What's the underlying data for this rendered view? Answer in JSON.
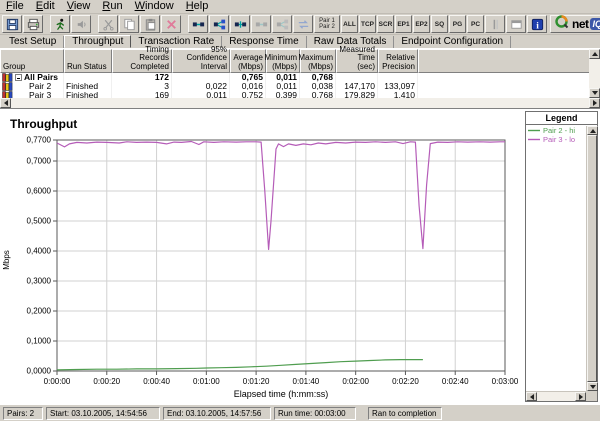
{
  "menu": {
    "items": [
      {
        "label": "File"
      },
      {
        "label": "Edit"
      },
      {
        "label": "View"
      },
      {
        "label": "Run"
      },
      {
        "label": "Window"
      },
      {
        "label": "Help"
      }
    ]
  },
  "toolbar": {
    "items": [
      {
        "type": "button",
        "name": "save-button",
        "icon": "floppy-icon",
        "enabled": true
      },
      {
        "type": "button",
        "name": "print-button",
        "icon": "printer-icon",
        "enabled": true
      },
      {
        "type": "separator"
      },
      {
        "type": "button",
        "name": "run-test-button",
        "icon": "runner-icon",
        "enabled": true
      },
      {
        "type": "button",
        "name": "stop-run-button",
        "icon": "speaker-icon",
        "enabled": false
      },
      {
        "type": "separator"
      },
      {
        "type": "button",
        "name": "cut-button",
        "icon": "scissors-icon",
        "enabled": false
      },
      {
        "type": "button",
        "name": "copy-button",
        "icon": "copy-icon",
        "enabled": false
      },
      {
        "type": "button",
        "name": "paste-button",
        "icon": "paste-icon",
        "enabled": false
      },
      {
        "type": "button",
        "name": "delete-button",
        "icon": "delete-x-icon",
        "enabled": true
      },
      {
        "type": "separator"
      },
      {
        "type": "button",
        "name": "add-pair-button",
        "icon": "pair-icon",
        "enabled": true
      },
      {
        "type": "button",
        "name": "add-multicast-group-button",
        "icon": "multi-pair-icon",
        "enabled": true
      },
      {
        "type": "button",
        "name": "add-through-pair-button",
        "icon": "through-pair-icon",
        "enabled": true
      },
      {
        "type": "button",
        "name": "edit-pair-button",
        "icon": "pair-gray-icon",
        "enabled": false
      },
      {
        "type": "button",
        "name": "duplicate-pair-button",
        "icon": "multi-pair-gray-icon",
        "enabled": false
      },
      {
        "type": "button",
        "name": "swap-endpoints-button",
        "icon": "swap-icon",
        "enabled": false
      },
      {
        "type": "pair-label-button",
        "name": "pair-view-button",
        "lines": [
          "Pair 1",
          "Pair 2"
        ]
      },
      {
        "type": "text-button",
        "name": "filter-all-button",
        "label": "ALL"
      },
      {
        "type": "text-button",
        "name": "filter-tcp-button",
        "label": "TCP"
      },
      {
        "type": "text-button",
        "name": "filter-scr-button",
        "label": "SCR"
      },
      {
        "type": "text-button",
        "name": "filter-ep1-button",
        "label": "EP1"
      },
      {
        "type": "text-button",
        "name": "filter-ep2-button",
        "label": "EP2"
      },
      {
        "type": "text-button",
        "name": "filter-sq-button",
        "label": "SQ"
      },
      {
        "type": "text-button",
        "name": "filter-pg-button",
        "label": "PG"
      },
      {
        "type": "text-button",
        "name": "filter-pc-button",
        "label": "PC"
      },
      {
        "type": "button",
        "name": "splitter-options-button",
        "icon": "columns-gray-icon",
        "enabled": false
      },
      {
        "type": "button",
        "name": "window-options-button",
        "icon": "window-gray-icon",
        "enabled": false
      },
      {
        "type": "button",
        "name": "help-info-button",
        "icon": "info-icon",
        "enabled": true
      },
      {
        "type": "logo",
        "name": "netiq-logo",
        "net": "net",
        "iq": "IQ"
      }
    ]
  },
  "tabs": [
    {
      "label": "Test Setup",
      "selected": false
    },
    {
      "label": "Throughput",
      "selected": true
    },
    {
      "label": "Transaction Rate",
      "selected": false
    },
    {
      "label": "Response Time",
      "selected": false
    },
    {
      "label": "Raw Data Totals",
      "selected": false
    },
    {
      "label": "Endpoint Configuration",
      "selected": false
    }
  ],
  "table": {
    "columns": [
      {
        "key": "group",
        "label": "Group"
      },
      {
        "key": "status",
        "label": "Run Status"
      },
      {
        "key": "timing",
        "label": "Timing Records\nCompleted"
      },
      {
        "key": "conf",
        "label": "95% Confidence\nInterval"
      },
      {
        "key": "avg",
        "label": "Average\n(Mbps)"
      },
      {
        "key": "min",
        "label": "Minimum\n(Mbps)"
      },
      {
        "key": "max",
        "label": "Maximum\n(Mbps)"
      },
      {
        "key": "measured",
        "label": "Measured\nTime (sec)"
      },
      {
        "key": "precision",
        "label": "Relative\nPrecision"
      }
    ],
    "rows": [
      {
        "group": "All Pairs",
        "level": 0,
        "expandable": true,
        "bold": true,
        "status": "",
        "timing": "172",
        "conf": "",
        "avg": "0,765",
        "min": "0,011",
        "max": "0,768",
        "measured": "",
        "precision": ""
      },
      {
        "group": "Pair 2",
        "level": 1,
        "expandable": false,
        "bold": false,
        "status": "Finished",
        "timing": "3",
        "conf": "0,022",
        "avg": "0,016",
        "min": "0,011",
        "max": "0,038",
        "measured": "147,170",
        "precision": "133,097"
      },
      {
        "group": "Pair 3",
        "level": 1,
        "expandable": false,
        "bold": false,
        "status": "Finished",
        "timing": "169",
        "conf": "0,011",
        "avg": "0,752",
        "min": "0,399",
        "max": "0,768",
        "measured": "179,829",
        "precision": "1,410"
      }
    ]
  },
  "chart_data": {
    "type": "line",
    "title": "Throughput",
    "xlabel": "Elapsed time (h:mm:ss)",
    "ylabel": "Mbps",
    "xlim": [
      0,
      180
    ],
    "ylim": [
      0,
      0.77
    ],
    "grid": true,
    "x_ticks": [
      {
        "v": 0,
        "label": "0:00:00"
      },
      {
        "v": 20,
        "label": "0:00:20"
      },
      {
        "v": 40,
        "label": "0:00:40"
      },
      {
        "v": 60,
        "label": "0:01:00"
      },
      {
        "v": 80,
        "label": "0:01:20"
      },
      {
        "v": 100,
        "label": "0:01:40"
      },
      {
        "v": 120,
        "label": "0:02:00"
      },
      {
        "v": 140,
        "label": "0:02:20"
      },
      {
        "v": 160,
        "label": "0:02:40"
      },
      {
        "v": 180,
        "label": "0:03:00"
      }
    ],
    "y_ticks": [
      {
        "v": 0,
        "label": "0,0000"
      },
      {
        "v": 0.1,
        "label": "0,1000"
      },
      {
        "v": 0.2,
        "label": "0,2000"
      },
      {
        "v": 0.3,
        "label": "0,3000"
      },
      {
        "v": 0.4,
        "label": "0,4000"
      },
      {
        "v": 0.5,
        "label": "0,5000"
      },
      {
        "v": 0.6,
        "label": "0,6000"
      },
      {
        "v": 0.7,
        "label": "0,7000"
      },
      {
        "v": 0.77,
        "label": "0,7700"
      }
    ],
    "series": [
      {
        "name": "Pair 2 - hi",
        "color": "#4f9d4f",
        "points": [
          [
            0,
            0.004
          ],
          [
            8,
            0.005
          ],
          [
            16,
            0.006
          ],
          [
            24,
            0.006
          ],
          [
            32,
            0.007
          ],
          [
            40,
            0.007
          ],
          [
            48,
            0.008
          ],
          [
            56,
            0.009
          ],
          [
            60,
            0.01
          ],
          [
            66,
            0.011
          ],
          [
            72,
            0.012
          ],
          [
            78,
            0.014
          ],
          [
            84,
            0.016
          ],
          [
            90,
            0.019
          ],
          [
            96,
            0.022
          ],
          [
            102,
            0.025
          ],
          [
            108,
            0.028
          ],
          [
            114,
            0.031
          ],
          [
            120,
            0.033
          ],
          [
            126,
            0.035
          ],
          [
            132,
            0.037
          ],
          [
            138,
            0.038
          ],
          [
            144,
            0.038
          ],
          [
            147,
            0.038
          ]
        ]
      },
      {
        "name": "Pair 3 - lo",
        "color": "#b55cb8",
        "points": [
          [
            0,
            0.76
          ],
          [
            3,
            0.747
          ],
          [
            5,
            0.757
          ],
          [
            8,
            0.762
          ],
          [
            12,
            0.76
          ],
          [
            16,
            0.763
          ],
          [
            20,
            0.762
          ],
          [
            25,
            0.76
          ],
          [
            28,
            0.764
          ],
          [
            32,
            0.762
          ],
          [
            36,
            0.763
          ],
          [
            40,
            0.762
          ],
          [
            44,
            0.757
          ],
          [
            47,
            0.763
          ],
          [
            50,
            0.762
          ],
          [
            54,
            0.765
          ],
          [
            57,
            0.755
          ],
          [
            59,
            0.764
          ],
          [
            63,
            0.762
          ],
          [
            67,
            0.764
          ],
          [
            72,
            0.763
          ],
          [
            76,
            0.764
          ],
          [
            80,
            0.764
          ],
          [
            82,
            0.763
          ],
          [
            83.5,
            0.6
          ],
          [
            85,
            0.405
          ],
          [
            86,
            0.5
          ],
          [
            88,
            0.74
          ],
          [
            89,
            0.757
          ],
          [
            91,
            0.748
          ],
          [
            93,
            0.757
          ],
          [
            96,
            0.752
          ],
          [
            99,
            0.757
          ],
          [
            102,
            0.754
          ],
          [
            105,
            0.76
          ],
          [
            108,
            0.757
          ],
          [
            112,
            0.762
          ],
          [
            116,
            0.76
          ],
          [
            120,
            0.763
          ],
          [
            124,
            0.762
          ],
          [
            128,
            0.764
          ],
          [
            132,
            0.762
          ],
          [
            136,
            0.764
          ],
          [
            139,
            0.758
          ],
          [
            142,
            0.764
          ],
          [
            144,
            0.763
          ],
          [
            145.5,
            0.55
          ],
          [
            147,
            0.408
          ],
          [
            148.5,
            0.62
          ],
          [
            150,
            0.758
          ],
          [
            153,
            0.763
          ],
          [
            157,
            0.762
          ],
          [
            161,
            0.764
          ],
          [
            165,
            0.763
          ],
          [
            170,
            0.764
          ],
          [
            174,
            0.763
          ],
          [
            178,
            0.764
          ],
          [
            180,
            0.764
          ]
        ]
      }
    ],
    "legend": {
      "title": "Legend",
      "position": "right",
      "entries": [
        {
          "label": "Pair 2 - hi",
          "color": "#4f9d4f"
        },
        {
          "label": "Pair 3 - lo",
          "color": "#b55cb8"
        }
      ]
    }
  },
  "status_bar": {
    "panels": [
      {
        "name": "pairs-count",
        "text": "Pairs: 2"
      },
      {
        "name": "start-time",
        "text": "Start: 03.10.2005, 14:54:56"
      },
      {
        "name": "end-time",
        "text": "End: 03.10.2005, 14:57:56"
      },
      {
        "name": "run-time",
        "text": "Run time: 00:03:00"
      },
      {
        "name": "completion-status",
        "text": "Ran to completion"
      }
    ]
  },
  "colors": {
    "chrome": "#d4d0c8",
    "grid": "#d2d2d2",
    "plot_border": "#5a5a5a",
    "pair2": "#4f9d4f",
    "pair3": "#b55cb8"
  }
}
